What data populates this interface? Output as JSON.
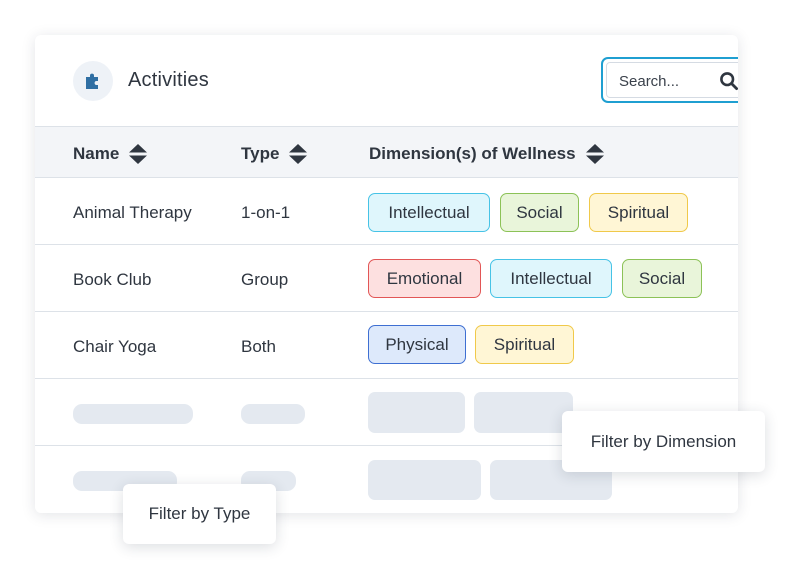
{
  "header": {
    "title": "Activities",
    "icon": "puzzle-piece-icon",
    "icon_color": "#2f6fa3"
  },
  "search": {
    "placeholder": "Search...",
    "value": "",
    "icon": "search-icon",
    "focus_color": "#1f9fd1"
  },
  "table": {
    "columns": [
      {
        "label": "Name",
        "sortable": true
      },
      {
        "label": "Type",
        "sortable": true
      },
      {
        "label": "Dimension(s) of Wellness",
        "sortable": true
      }
    ],
    "rows": [
      {
        "name": "Animal Therapy",
        "type": "1-on-1",
        "dimensions": [
          "Intellectual",
          "Social",
          "Spiritual"
        ]
      },
      {
        "name": "Book Club",
        "type": "Group",
        "dimensions": [
          "Emotional",
          "Intellectual",
          "Social"
        ]
      },
      {
        "name": "Chair Yoga",
        "type": "Both",
        "dimensions": [
          "Physical",
          "Spiritual"
        ]
      }
    ]
  },
  "dimension_colors": {
    "Intellectual": "#46c3e6",
    "Social": "#8cc257",
    "Spiritual": "#f0c94a",
    "Emotional": "#e25656",
    "Physical": "#3e6fd2"
  },
  "popovers": {
    "filter_dimension": "Filter by Dimension",
    "filter_type": "Filter by Type"
  }
}
